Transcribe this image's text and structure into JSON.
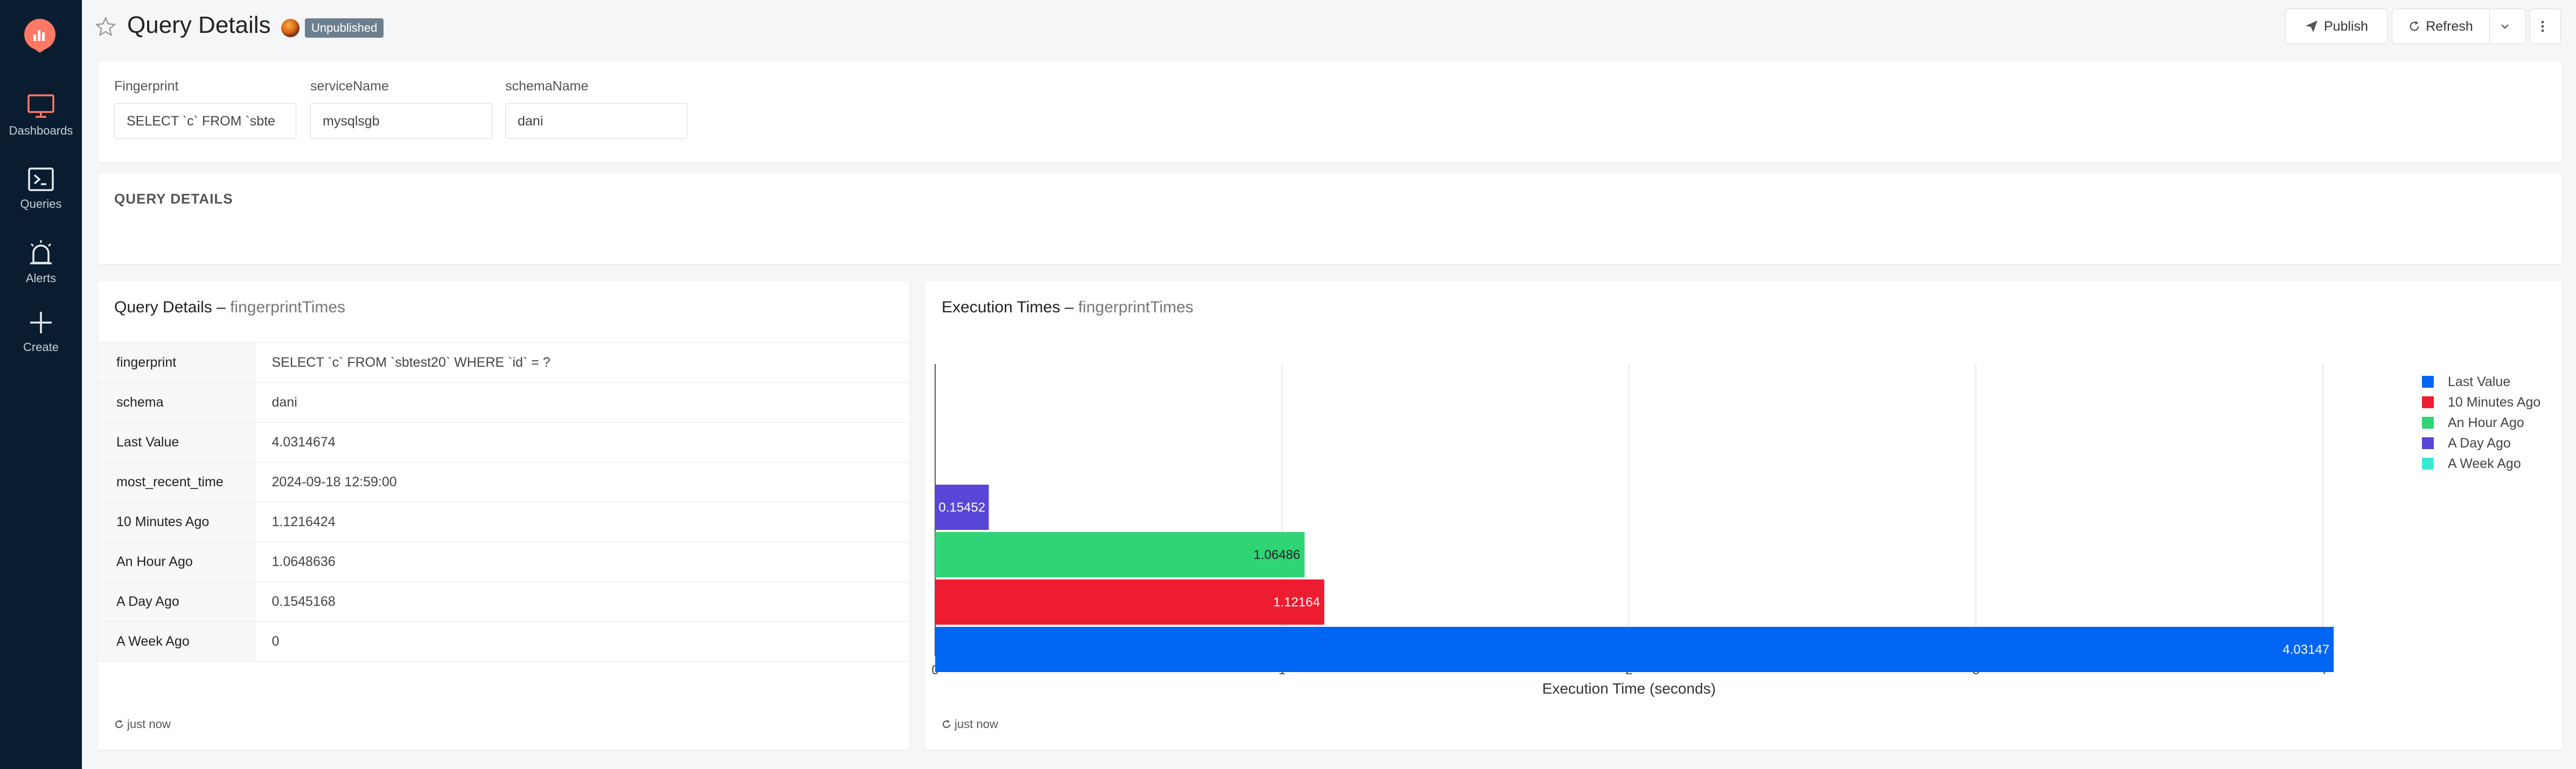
{
  "sidebar": {
    "items": [
      {
        "label": "Dashboards",
        "icon": "monitor-icon"
      },
      {
        "label": "Queries",
        "icon": "terminal-icon"
      },
      {
        "label": "Alerts",
        "icon": "alarm-icon"
      },
      {
        "label": "Create",
        "icon": "plus-icon"
      }
    ]
  },
  "header": {
    "title": "Query Details",
    "badge": "Unpublished",
    "publish_label": "Publish",
    "refresh_label": "Refresh"
  },
  "params": [
    {
      "label": "Fingerprint",
      "value": "SELECT `c` FROM `sbte"
    },
    {
      "label": "serviceName",
      "value": "mysqlsgb"
    },
    {
      "label": "schemaName",
      "value": "dani"
    }
  ],
  "section_title": "QUERY DETAILS",
  "details_card": {
    "title": "Query Details",
    "subtitle": "fingerprintTimes",
    "rows": [
      {
        "key": "fingerprint",
        "value": "SELECT `c` FROM `sbtest20` WHERE `id` = ?"
      },
      {
        "key": "schema",
        "value": "dani"
      },
      {
        "key": "Last Value",
        "value": "4.0314674"
      },
      {
        "key": "most_recent_time",
        "value": "2024-09-18 12:59:00"
      },
      {
        "key": "10 Minutes Ago",
        "value": "1.1216424"
      },
      {
        "key": "An Hour Ago",
        "value": "1.0648636"
      },
      {
        "key": "A Day Ago",
        "value": "0.1545168"
      },
      {
        "key": "A Week Ago",
        "value": "0"
      }
    ],
    "updated": "just now"
  },
  "chart_card": {
    "title": "Execution Times",
    "subtitle": "fingerprintTimes",
    "updated": "just now"
  },
  "chart_data": {
    "type": "bar",
    "orientation": "horizontal",
    "xlabel": "Execution Time (seconds)",
    "xticks": [
      "0",
      "1",
      "2",
      "3",
      "4"
    ],
    "xlim": [
      0,
      4.1
    ],
    "grid": true,
    "legend_position": "right",
    "series": [
      {
        "name": "Last Value",
        "value": 4.03147,
        "label": "4.03147",
        "color": "#0065f2"
      },
      {
        "name": "10 Minutes Ago",
        "value": 1.12164,
        "label": "1.12164",
        "color": "#ee1c30"
      },
      {
        "name": "An Hour Ago",
        "value": 1.06486,
        "label": "1.06486",
        "color": "#2fd575"
      },
      {
        "name": "A Day Ago",
        "value": 0.15452,
        "label": "0.15452",
        "color": "#5846d8"
      },
      {
        "name": "A Week Ago",
        "value": 0,
        "label": "",
        "color": "#3de8d3"
      }
    ]
  }
}
